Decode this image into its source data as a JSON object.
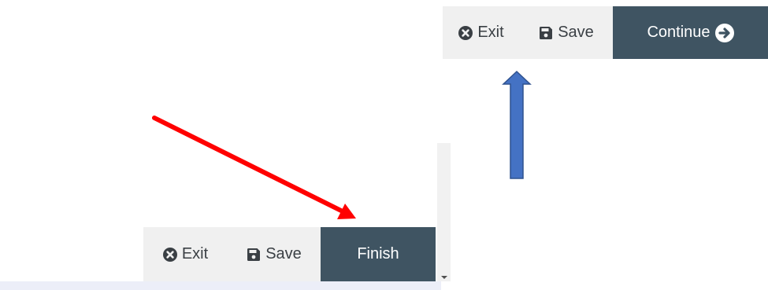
{
  "top_toolbar": {
    "exit_label": "Exit",
    "save_label": "Save",
    "continue_label": "Continue"
  },
  "bottom_toolbar": {
    "exit_label": "Exit",
    "save_label": "Save",
    "finish_label": "Finish"
  },
  "icons": {
    "exit": "times-circle-icon",
    "save": "floppy-disk-icon",
    "continue": "arrow-circle-right-icon"
  },
  "colors": {
    "primary_button": "#3f5462",
    "toolbar_background": "#f0f0f0",
    "text": "#3a3f44",
    "annotation_red_arrow": "#ff0000",
    "annotation_blue_arrow": "#4472c4"
  }
}
